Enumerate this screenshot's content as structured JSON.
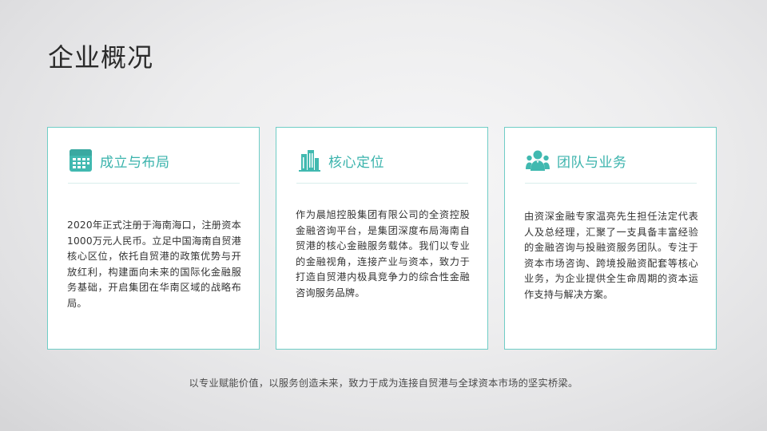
{
  "page": {
    "title": "企业概况",
    "footer": "以专业赋能价值，以服务创造未来，致力于成为连接自贸港与全球资本市场的坚实桥梁。"
  },
  "colors": {
    "accent": "#3ab3ac",
    "card_border": "#6fcdc6",
    "title_text": "#2b2b2b",
    "body_text": "#333333"
  },
  "cards": [
    {
      "icon": "calendar-icon",
      "title": "成立与布局",
      "body": "2020年正式注册于海南海口，注册资本1000万元人民币。立足中国海南自贸港核心区位，依托自贸港的政策优势与开放红利，构建面向未来的国际化金融服务基础，开启集团在华南区域的战略布局。"
    },
    {
      "icon": "building-icon",
      "title": "核心定位",
      "body": "作为晨旭控股集团有限公司的全资控股金融咨询平台，是集团深度布局海南自贸港的核心金融服务载体。我们以专业的金融视角，连接产业与资本，致力于打造自贸港内极具竞争力的综合性金融咨询服务品牌。"
    },
    {
      "icon": "team-icon",
      "title": "团队与业务",
      "body": "由资深金融专家温亮先生担任法定代表人及总经理，汇聚了一支具备丰富经验的金融咨询与投融资服务团队。专注于资本市场咨询、跨境投融资配套等核心业务，为企业提供全生命周期的资本运作支持与解决方案。"
    }
  ]
}
